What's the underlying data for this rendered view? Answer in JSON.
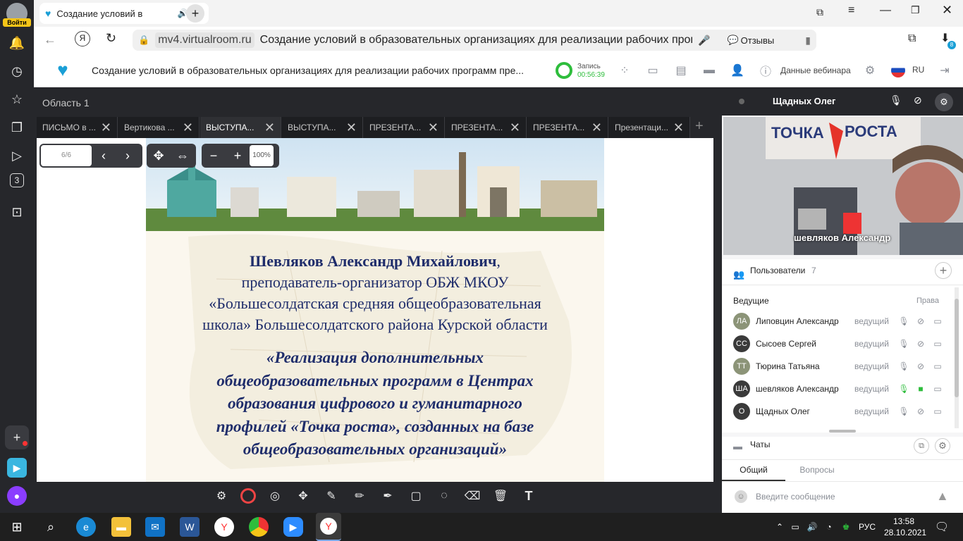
{
  "browser": {
    "login_label": "Войти",
    "tab_title": "Создание условий в",
    "url_domain": "mv4.virtualroom.ru",
    "page_title": "Создание условий в образовательных организациях для реализации рабочих программ п...",
    "feedback_label": "Отзывы",
    "downloads_badge": "8",
    "sidebar_badge": "3"
  },
  "app": {
    "title": "Создание условий в образовательных организациях для реализации рабочих программ пре...",
    "record_label": "Запись",
    "record_time": "00:56:39",
    "webinar_data_label": "Данные вебинара",
    "lang": "RU"
  },
  "stage": {
    "area_title": "Область 1",
    "doc_tabs": [
      "ПИСЬМО в ...",
      "Вертикова ...",
      "ВЫСТУПА...",
      "ВЫСТУПА...",
      "ПРЕЗЕНТА...",
      "ПРЕЗЕНТА...",
      "ПРЕЗЕНТА...",
      "Презентаци..."
    ],
    "active_tab_index": 2,
    "page_indicator": "6/6",
    "zoom": "100%"
  },
  "slide": {
    "author_name": "Шевляков Александр Михайлович",
    "author_comma": ",",
    "author_line2": "преподаватель-организатор ОБЖ МКОУ",
    "author_line3": "«Большесолдатская средняя общеобразовательная",
    "author_line4": "школа» Большесолдатского района Курской области",
    "topic_lines": [
      "«Реализация дополнительных",
      "общеобразовательных программ в Центрах",
      "образования цифрового и гуманитарного",
      "профилей «Точка роста», созданных на базе",
      "общеобразовательных организаций»"
    ]
  },
  "video": {
    "presenter": "Щадных Олег",
    "speaker_label": "шевляков Александр",
    "banner_text_left": "ТОЧКА",
    "banner_text_right": "РОСТА"
  },
  "users": {
    "title": "Пользователи",
    "count": "7",
    "section": "Ведущие",
    "rights_label": "Права",
    "list": [
      {
        "initials": "ЛА",
        "name": "Липовцин Александр",
        "role": "ведущий",
        "color": "#8c9478"
      },
      {
        "initials": "СС",
        "name": "Сысоев Сергей",
        "role": "ведущий",
        "color": "#3a3a3a"
      },
      {
        "initials": "ТТ",
        "name": "Тюрина Татьяна",
        "role": "ведущий",
        "color": "#8c9478"
      },
      {
        "initials": "ША",
        "name": "шевляков Александр",
        "role": "ведущий",
        "color": "#3a3a3a"
      },
      {
        "initials": "О",
        "name": "Щадных Олег",
        "role": "ведущий",
        "color": "#3a3a3a"
      }
    ]
  },
  "chats": {
    "title": "Чаты",
    "tab_general": "Общий",
    "tab_questions": "Вопросы",
    "input_placeholder": "Введите сообщение"
  },
  "taskbar": {
    "lang": "РУС",
    "time": "13:58",
    "date": "28.10.2021"
  },
  "colors": {
    "accent_green": "#2ebd3c",
    "yandex_red": "#f33",
    "stage_bg": "#26272b"
  }
}
